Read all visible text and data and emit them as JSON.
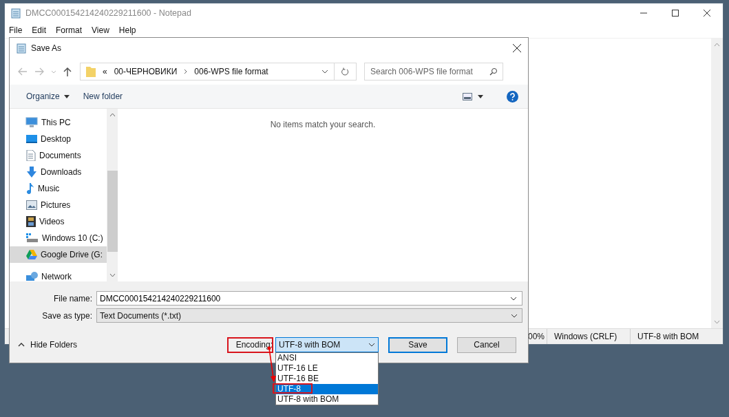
{
  "notepad": {
    "title": "DMCC000154214240229211600 - Notepad",
    "menu": [
      "File",
      "Edit",
      "Format",
      "View",
      "Help"
    ],
    "status_bar": [
      "00%",
      "Windows (CRLF)",
      "UTF-8 with BOM"
    ]
  },
  "dialog": {
    "title": "Save As",
    "breadcrumb": [
      "«",
      "00-ЧЕРНОВИКИ",
      "006-WPS file format"
    ],
    "search": {
      "placeholder": "Search 006-WPS file format"
    },
    "toolbar": [
      {
        "label": "Organize",
        "kind": "menu"
      },
      {
        "label": "New folder",
        "kind": "button"
      }
    ],
    "sidebar": {
      "items": [
        {
          "label": "This PC",
          "kind": "pc",
          "selected": false,
          "children": [
            {
              "label": "Desktop",
              "kind": "desktop",
              "selected": false
            },
            {
              "label": "Documents",
              "kind": "documents",
              "selected": false
            },
            {
              "label": "Downloads",
              "kind": "downloads",
              "selected": false
            },
            {
              "label": "Music",
              "kind": "music",
              "selected": false
            },
            {
              "label": "Pictures",
              "kind": "pictures",
              "selected": false
            },
            {
              "label": "Videos",
              "kind": "videos",
              "selected": false
            },
            {
              "label": "Windows 10 (C:)",
              "kind": "disk",
              "selected": false
            },
            {
              "label": "Google Drive (G:",
              "kind": "cloud",
              "selected": true
            }
          ]
        },
        {
          "label": "Network",
          "kind": "network",
          "selected": false
        }
      ]
    },
    "empty_message": "No items match your search.",
    "file_name": {
      "label": "File name:",
      "value": "DMCC000154214240229211600"
    },
    "save_as_type": {
      "label": "Save as type:",
      "value": "Text Documents (*.txt)"
    },
    "hide_folders": "Hide Folders",
    "encoding": {
      "label": "Encoding:",
      "value": "UTF-8 with BOM",
      "expanded": true,
      "options": [
        {
          "label": "ANSI",
          "highlighted": false
        },
        {
          "label": "UTF-16 LE",
          "highlighted": false
        },
        {
          "label": "UTF-16 BE",
          "highlighted": false
        },
        {
          "label": "UTF-8",
          "highlighted": true
        },
        {
          "label": "UTF-8 with BOM",
          "highlighted": false
        }
      ]
    },
    "buttons": [
      {
        "label": "Save",
        "kind": "default"
      },
      {
        "label": "Cancel",
        "kind": "normal"
      }
    ]
  }
}
